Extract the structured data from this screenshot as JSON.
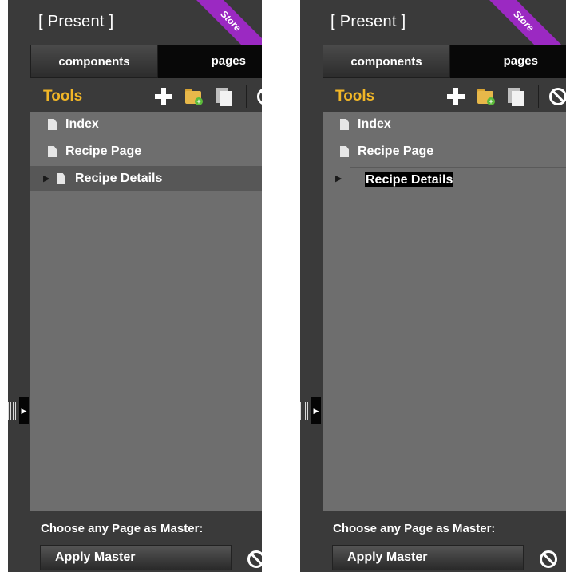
{
  "panels": [
    {
      "title": "[ Present ]",
      "store_badge": "Store",
      "tabs": [
        "components",
        "pages"
      ],
      "tools_label": "Tools",
      "pages": [
        {
          "label": "Index"
        },
        {
          "label": "Recipe Page"
        },
        {
          "label": "Recipe Details",
          "expandable": true,
          "selected": true
        }
      ],
      "footer_label": "Choose any Page as Master:",
      "apply_button": "Apply Master"
    },
    {
      "title": "[ Present ]",
      "store_badge": "Store",
      "tabs": [
        "components",
        "pages"
      ],
      "tools_label": "Tools",
      "pages": [
        {
          "label": "Index"
        },
        {
          "label": "Recipe Page"
        },
        {
          "label": "Recipe Details",
          "expandable": true,
          "editing": true
        }
      ],
      "footer_label": "Choose any Page as Master:",
      "apply_button": "Apply Master"
    }
  ],
  "icons": {
    "add": "plus-icon",
    "new_folder": "folder-add-icon",
    "duplicate": "copy-icon",
    "disable": "prohibit-icon",
    "page": "document-icon",
    "expand": "triangle-right-icon",
    "collapse_handle": "grip-icon"
  },
  "colors": {
    "panel_bg": "#3a3a3a",
    "list_bg": "#6e6e6e",
    "selected_row": "#575757",
    "tools_label": "#f1b627",
    "store_ribbon": "#9b29c2",
    "pages_tab": "#080808"
  }
}
